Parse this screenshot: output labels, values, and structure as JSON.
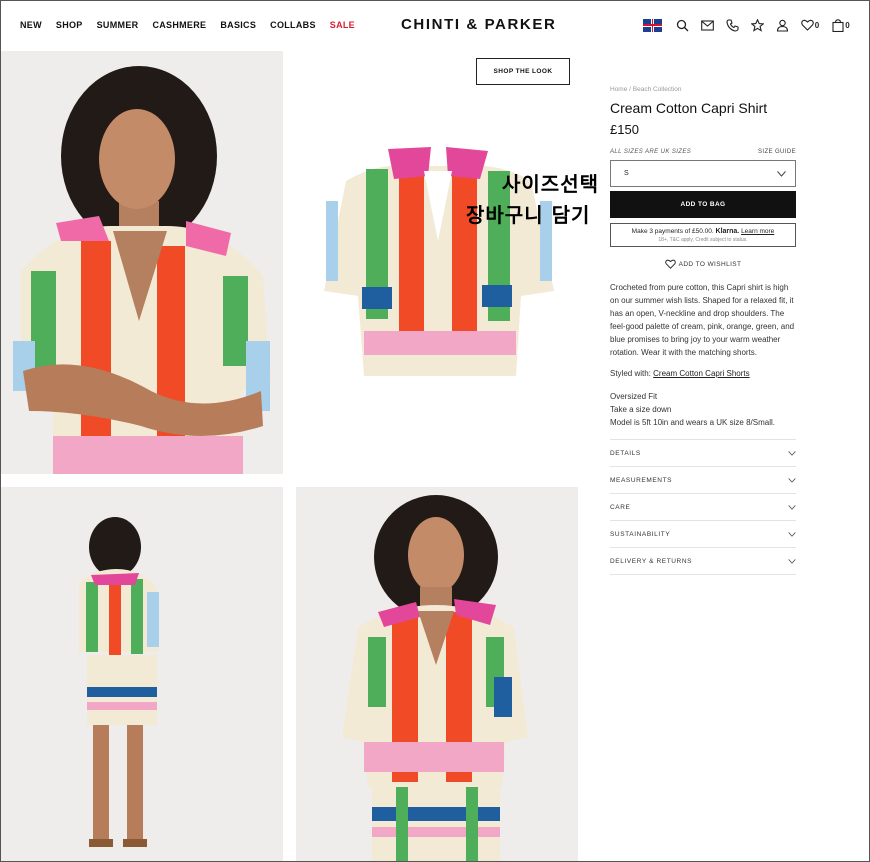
{
  "header": {
    "nav": [
      "NEW",
      "SHOP",
      "SUMMER",
      "CASHMERE",
      "BASICS",
      "COLLABS",
      "SALE"
    ],
    "logo": "CHINTI & PARKER",
    "wishlist_count": "0",
    "bag_count": "0"
  },
  "gallery": {
    "shop_the_look": "SHOP THE LOOK"
  },
  "overlay": {
    "line1": "사이즈선택",
    "line2": "장바구니 담기"
  },
  "product": {
    "breadcrumb": "Home / Beach Collection",
    "title": "Cream Cotton Capri Shirt",
    "price": "£150",
    "sizes_note": "ALL SIZES ARE UK SIZES",
    "size_guide": "SIZE GUIDE",
    "selected_size": "S",
    "add_to_bag": "ADD TO BAG",
    "klarna_line_pre": "Make 3 payments of £50.00.",
    "klarna_brand": "Klarna.",
    "klarna_link": "Learn more",
    "klarna_note": "18+, T&C apply, Credit subject to status.",
    "wishlist": "ADD TO WISHLIST",
    "description": "Crocheted from pure cotton, this Capri shirt is high on our summer wish lists. Shaped for a relaxed fit, it has an open, V-neckline and drop shoulders. The feel-good palette of cream, pink, orange, green, and blue promises to bring joy to your warm weather rotation. Wear it with the matching shorts.",
    "styled_label": "Styled with:",
    "styled_link": "Cream Cotton Capri Shorts",
    "fit_1": "Oversized Fit",
    "fit_2": "Take a size down",
    "fit_3": "Model is 5ft 10in and wears a UK size 8/Small.",
    "accordion": [
      "DETAILS",
      "MEASUREMENTS",
      "CARE",
      "SUSTAINABILITY",
      "DELIVERY & RETURNS"
    ]
  },
  "colors": {
    "sale": "#d6202e",
    "cream": "#f3ead6",
    "pink": "#f06aa8",
    "orange": "#f04a26",
    "green": "#4fae5a",
    "blue": "#1f5fa0",
    "lightblue": "#a8d0ea"
  }
}
